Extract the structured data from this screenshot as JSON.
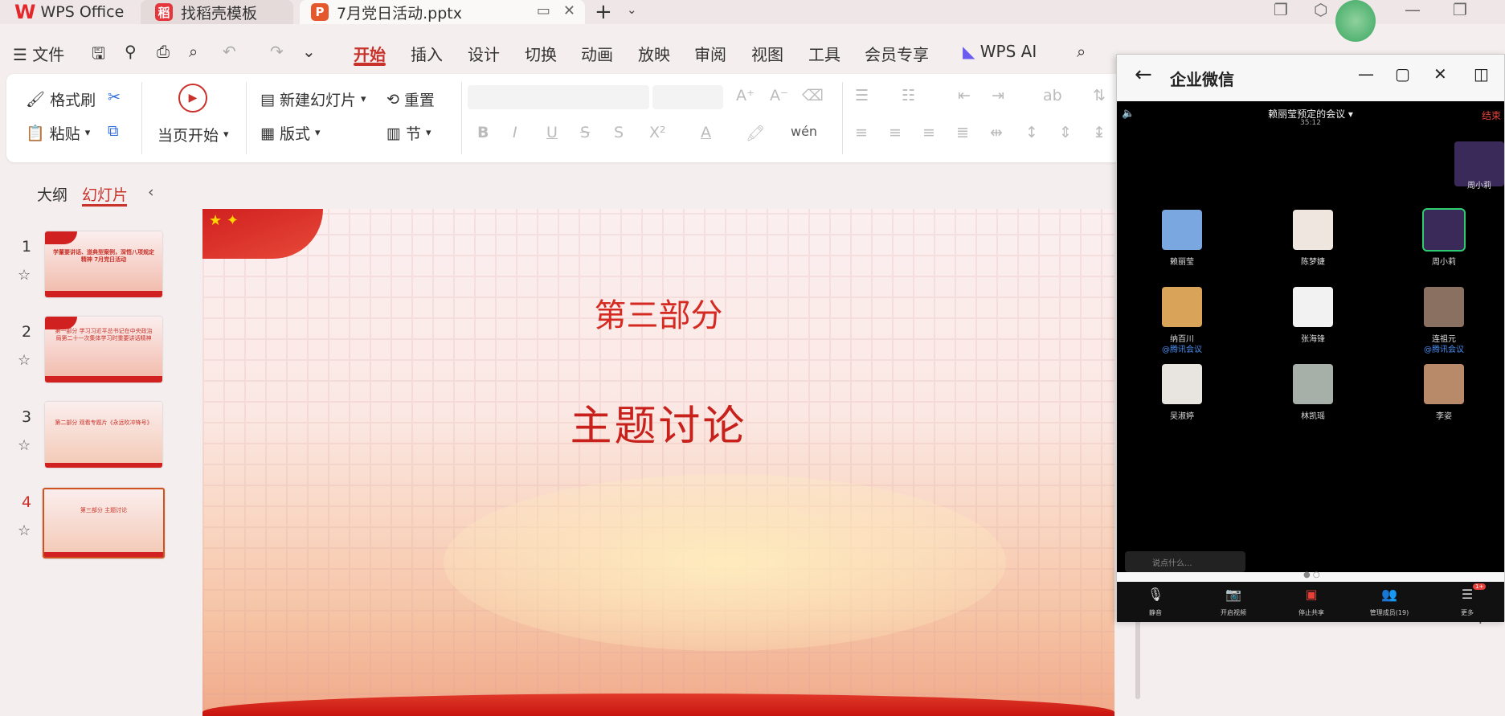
{
  "tabs": {
    "wps": "WPS Office",
    "template": "找稻壳模板",
    "document": "7月党日活动.pptx",
    "new": "+",
    "more": "⌄"
  },
  "menu": {
    "file": "文件",
    "items": [
      "开始",
      "插入",
      "设计",
      "切换",
      "动画",
      "放映",
      "审阅",
      "视图",
      "工具",
      "会员专享"
    ],
    "wps_ai": "WPS AI"
  },
  "ribbon": {
    "format_painter": "格式刷",
    "paste": "粘贴",
    "play_from_current": "当页开始",
    "new_slide": "新建幻灯片",
    "reset": "重置",
    "layout": "版式",
    "section": "节",
    "bold": "B",
    "italic": "I",
    "underline": "U",
    "strike": "S",
    "shadow": "S",
    "superscript": "X²",
    "font_color": "A",
    "text_effect": "A",
    "phonetic": "wén"
  },
  "left_panel": {
    "outline_tab": "大纲",
    "slides_tab": "幻灯片",
    "slides": [
      {
        "num": "1",
        "text": "学董要讲话、道典型案例，深悟八项规定精神 7月党日活动"
      },
      {
        "num": "2",
        "text": "第一部分 学习习近平总书记在中央政治局第二十一次集体学习时重要讲话精神"
      },
      {
        "num": "3",
        "text": "第二部分 观看专题片《永远吹冲锋号》"
      },
      {
        "num": "4",
        "text": "第三部分 主题讨论"
      }
    ]
  },
  "slide": {
    "subtitle": "第三部分",
    "title": "主题讨论"
  },
  "wecom": {
    "title": "企业微信",
    "meeting_title": "赖丽莹预定的会议 ▾",
    "meeting_time": "35:12",
    "end": "结束",
    "top_user": "周小莉",
    "participants": [
      {
        "name": "赖丽莹",
        "tag": "",
        "color": "#7ba7e0"
      },
      {
        "name": "陈梦婕",
        "tag": "",
        "color": "#f0e6e0"
      },
      {
        "name": "周小莉",
        "tag": "",
        "color": "#3a2a5a"
      },
      {
        "name": "纳百川",
        "tag": "@腾讯会议",
        "color": "#d9a35a"
      },
      {
        "name": "张海锋",
        "tag": "",
        "color": "#f2f2f2"
      },
      {
        "name": "连祖元",
        "tag": "@腾讯会议",
        "color": "#8a7060"
      },
      {
        "name": "吴淑婷",
        "tag": "",
        "color": "#e8e4df"
      },
      {
        "name": "林凯瑶",
        "tag": "",
        "color": "#a6b0a8"
      },
      {
        "name": "李姿",
        "tag": "",
        "color": "#b98a6a"
      }
    ],
    "chat_placeholder": "说点什么...",
    "toolbar": [
      "静音",
      "开启视频",
      "停止共享",
      "管理成员(19)",
      "更多"
    ],
    "badge": "1+"
  }
}
